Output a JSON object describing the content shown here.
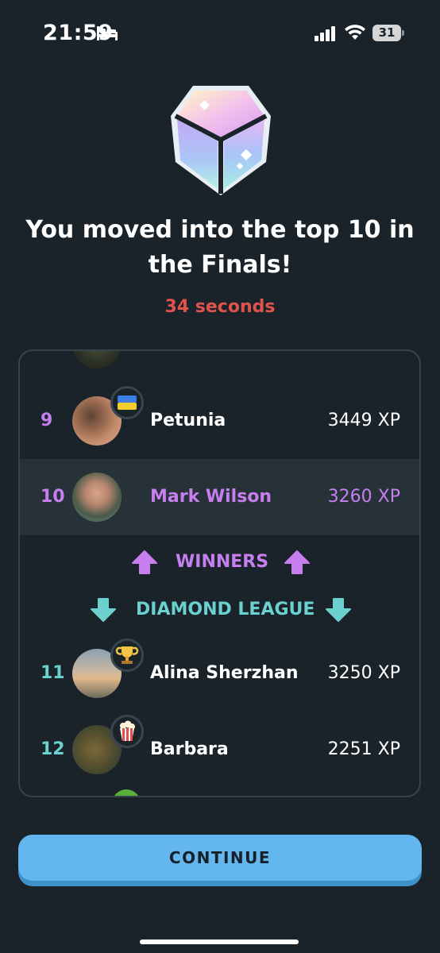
{
  "status_bar": {
    "time": "21:59",
    "battery": "31",
    "icons": [
      "bed-icon",
      "cellular-signal-icon",
      "wifi-icon",
      "battery-icon"
    ]
  },
  "hero": {
    "icon": "diamond-gem-icon",
    "headline": "You moved into the top 10 in the Finals!",
    "timer": "34 seconds"
  },
  "leaderboard": {
    "rows": [
      {
        "rank": "9",
        "name": "Petunia",
        "xp": "3449 XP",
        "badge": "ukraine-flag-icon"
      },
      {
        "rank": "10",
        "name": "Mark Wilson",
        "xp": "3260 XP",
        "highlighted": true
      },
      {
        "rank": "11",
        "name": "Alina Sherzhan",
        "xp": "3250 XP",
        "badge": "trophy-icon"
      },
      {
        "rank": "12",
        "name": "Barbara",
        "xp": "2251 XP",
        "badge": "popcorn-icon"
      }
    ],
    "winners_label": "WINNERS",
    "diamond_label": "DIAMOND LEAGUE"
  },
  "actions": {
    "continue_label": "CONTINUE"
  },
  "colors": {
    "background": "#1a2329",
    "winner_purple": "#c77ff0",
    "league_teal": "#6ad1cf",
    "timer_red": "#e0534c",
    "button_blue": "#64b7ee"
  }
}
